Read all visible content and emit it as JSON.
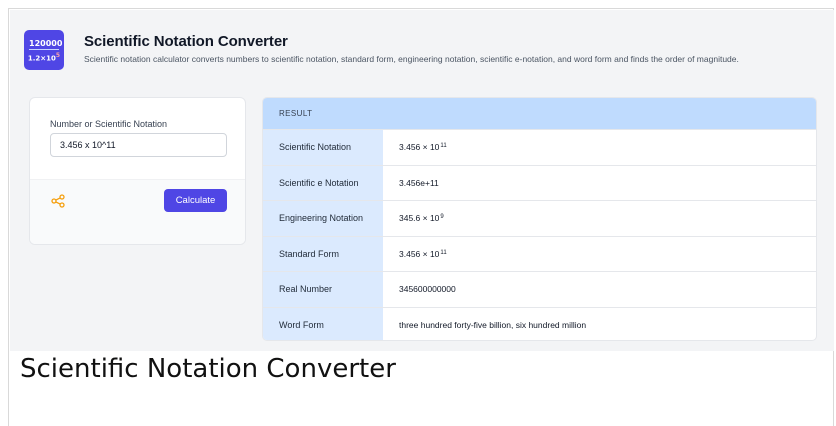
{
  "app": {
    "title": "Scientific Notation Converter",
    "description": "Scientific notation calculator converts numbers to scientific notation, standard form, engineering notation, scientific e-notation, and word form and finds the order of magnitude.",
    "logo_top": "120000",
    "logo_bottom_base": "1.2×10",
    "logo_bottom_exp": "5"
  },
  "input": {
    "label": "Number or Scientific Notation",
    "value": "3.456 x 10^11"
  },
  "actions": {
    "calculate_label": "Calculate",
    "share_icon": "share-icon"
  },
  "result": {
    "header": "RESULT",
    "rows": [
      {
        "key": "Scientific Notation",
        "base": "3.456 × 10",
        "exp": "11"
      },
      {
        "key": "Scientific e Notation",
        "base": "3.456e+11",
        "exp": ""
      },
      {
        "key": "Engineering Notation",
        "base": "345.6 × 10",
        "exp": "9"
      },
      {
        "key": "Standard Form",
        "base": "3.456 × 10",
        "exp": "11"
      },
      {
        "key": "Real Number",
        "base": "345600000000",
        "exp": ""
      },
      {
        "key": "Word Form",
        "base": "three hundred forty-five billion, six hundred million",
        "exp": ""
      }
    ]
  },
  "caption": "Scientific Notation Converter",
  "colors": {
    "accent": "#4f46e5",
    "result_header": "#bfdbfe",
    "result_key_bg": "#dbeafe",
    "share_icon": "#f59e0b"
  }
}
